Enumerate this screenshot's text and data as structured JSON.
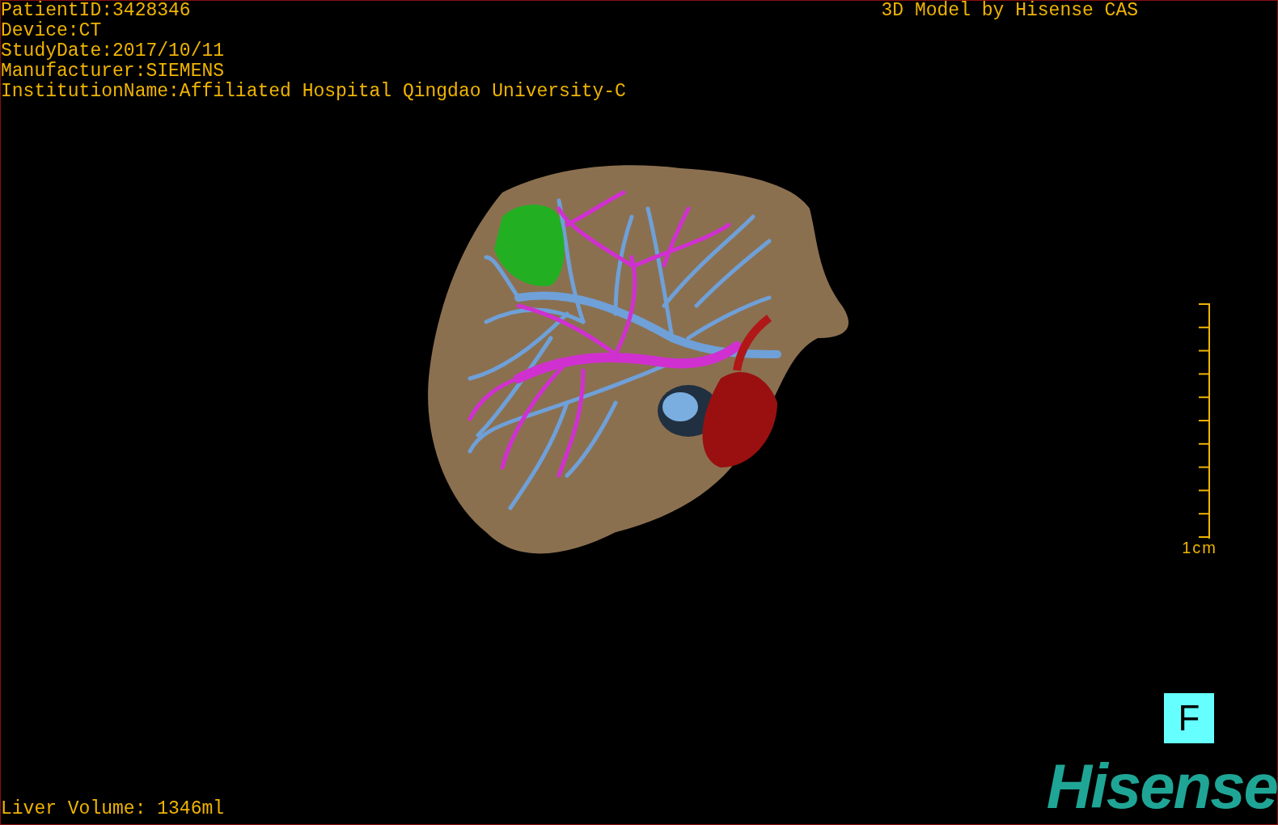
{
  "info_lines": [
    "PatientID:3428346",
    "Device:CT",
    "StudyDate:2017/10/11",
    "Manufacturer:SIEMENS",
    "InstitutionName:Affiliated Hospital Qingdao University-C"
  ],
  "title": "3D Model by Hisense CAS",
  "scale_label": "1cm",
  "orientation_marker": "F",
  "liver_volume": "Liver Volume: 1346ml",
  "logo": "Hisense"
}
